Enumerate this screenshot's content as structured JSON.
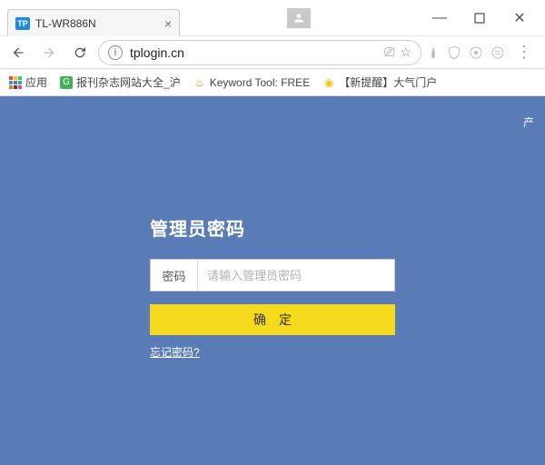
{
  "window": {
    "minimize_glyph": "—",
    "close_glyph": "✕"
  },
  "tab": {
    "favicon_text": "TP",
    "title": "TL-WR886N"
  },
  "nav": {
    "url": "tplogin.cn",
    "star_glyph": "☆",
    "qr_glyph": "⎚"
  },
  "toolbar": {
    "menu_glyph": "⋮"
  },
  "bookmarks": {
    "apps": "应用",
    "items": [
      {
        "icon_text": "G",
        "label": "报刊杂志网站大全_沪"
      },
      {
        "label": "Keyword Tool: FREE"
      },
      {
        "label": "【新提醒】大气门户"
      }
    ]
  },
  "page": {
    "corner_text": "产",
    "heading": "管理员密码",
    "password_label": "密码",
    "password_placeholder": "请输入管理员密码",
    "submit_label": "确定",
    "forgot_label": "忘记密码?"
  }
}
